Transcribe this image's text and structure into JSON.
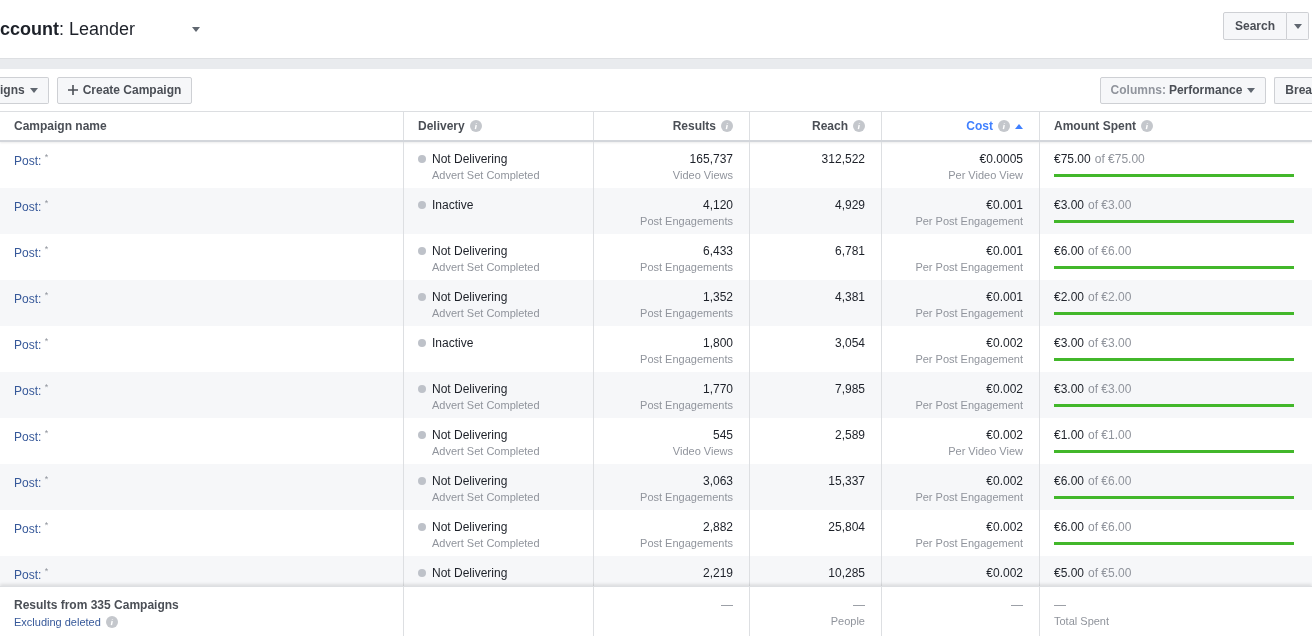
{
  "header": {
    "account": "**ccount**: Leander",
    "search_button": "Search"
  },
  "toolbar": {
    "left_buttons": [
      {
        "label": "igns",
        "dropdown": true
      },
      {
        "label": "Create Campaign",
        "kind": "create"
      }
    ],
    "right_buttons": [
      {
        "label": "Columns:",
        "value": "Performance",
        "dropdown": true
      },
      {
        "label": "Brea"
      }
    ]
  },
  "table": {
    "columns": [
      {
        "label": "Campaign name",
        "info": false,
        "sorted": false
      },
      {
        "label": "Delivery",
        "info": true,
        "sorted": false
      },
      {
        "label": "Results",
        "info": true,
        "sorted": false
      },
      {
        "label": "Reach",
        "info": true,
        "sorted": false
      },
      {
        "label": "Cost",
        "info": true,
        "sorted": true
      },
      {
        "label": "Amount Spent",
        "info": true,
        "sorted": false
      }
    ],
    "rows": [
      {
        "name": "Post: $^{*}$",
        "delivery": "Not Delivering",
        "delivery_note": "Advert Set Completed",
        "results": "165,737",
        "results_note": "Video Views",
        "reach": "312,522",
        "cost": "€0.0005",
        "cost_note": "Per Video View",
        "spent": "€75.00",
        "budget": "of €75.00",
        "level": 1
      },
      {
        "name": "Post: $^{*}$",
        "delivery": "Inactive",
        "results": "4,120",
        "results_note": "Post Engagements",
        "reach": "4,929",
        "cost": "€0.001",
        "cost_note": "Per Post Engagement",
        "spent": "€3.00",
        "budget": "of €3.00",
        "level": 1
      },
      {
        "name": "Post: $^{*}$",
        "delivery": "Not Delivering",
        "delivery_note": "Advert Set Completed",
        "results": "6,433",
        "results_note": "Post Engagements",
        "reach": "6,781",
        "cost": "€0.001",
        "cost_note": "Per Post Engagement",
        "spent": "€6.00",
        "budget": "of €6.00",
        "level": 1
      },
      {
        "name": "Post: $^{*}$",
        "delivery": "Not Delivering",
        "delivery_note": "Advert Set Completed",
        "results": "1,352",
        "results_note": "Post Engagements",
        "reach": "4,381",
        "cost": "€0.001",
        "cost_note": "Per Post Engagement",
        "spent": "€2.00",
        "budget": "of €2.00",
        "level": 1
      },
      {
        "name": "Post: $^{*}$",
        "delivery": "Inactive",
        "results": "1,800",
        "results_note": "Post Engagements",
        "reach": "3,054",
        "cost": "€0.002",
        "cost_note": "Per Post Engagement",
        "spent": "€3.00",
        "budget": "of €3.00",
        "level": 1
      },
      {
        "name": "Post: $^{*}$",
        "delivery": "Not Delivering",
        "delivery_note": "Advert Set Completed",
        "results": "1,770",
        "results_note": "Post Engagements",
        "reach": "7,985",
        "cost": "€0.002",
        "cost_note": "Per Post Engagement",
        "spent": "€3.00",
        "budget": "of €3.00",
        "level": 1
      },
      {
        "name": "Post: $^{*}$",
        "delivery": "Not Delivering",
        "delivery_note": "Advert Set Completed",
        "results": "545",
        "results_note": "Video Views",
        "reach": "2,589",
        "cost": "€0.002",
        "cost_note": "Per Video View",
        "spent": "€1.00",
        "budget": "of €1.00",
        "level": 1
      },
      {
        "name": "Post: $^{*}$",
        "delivery": "Not Delivering",
        "delivery_note": "Advert Set Completed",
        "results": "3,063",
        "results_note": "Post Engagements",
        "reach": "15,337",
        "cost": "€0.002",
        "cost_note": "Per Post Engagement",
        "spent": "€6.00",
        "budget": "of €6.00",
        "level": 1
      },
      {
        "name": "Post: $^{*}$",
        "delivery": "Not Delivering",
        "delivery_note": "Advert Set Completed",
        "results": "2,882",
        "results_note": "Post Engagements",
        "reach": "25,804",
        "cost": "€0.002",
        "cost_note": "Per Post Engagement",
        "spent": "€6.00",
        "budget": "of €6.00",
        "level": 1
      },
      {
        "name": "Post: $^{*}$",
        "delivery": "Not Delivering",
        "results": "2,219",
        "reach": "10,285",
        "cost": "€0.002",
        "spent": "€5.00",
        "budget": "of €5.00"
      }
    ],
    "footer": {
      "title": "Results from 335 Campaigns",
      "link": "Excluding deleted",
      "results": "—",
      "reach": "—",
      "reach_note": "People",
      "cost": "—",
      "spent": "—",
      "spent_note": "Total Spent"
    }
  }
}
